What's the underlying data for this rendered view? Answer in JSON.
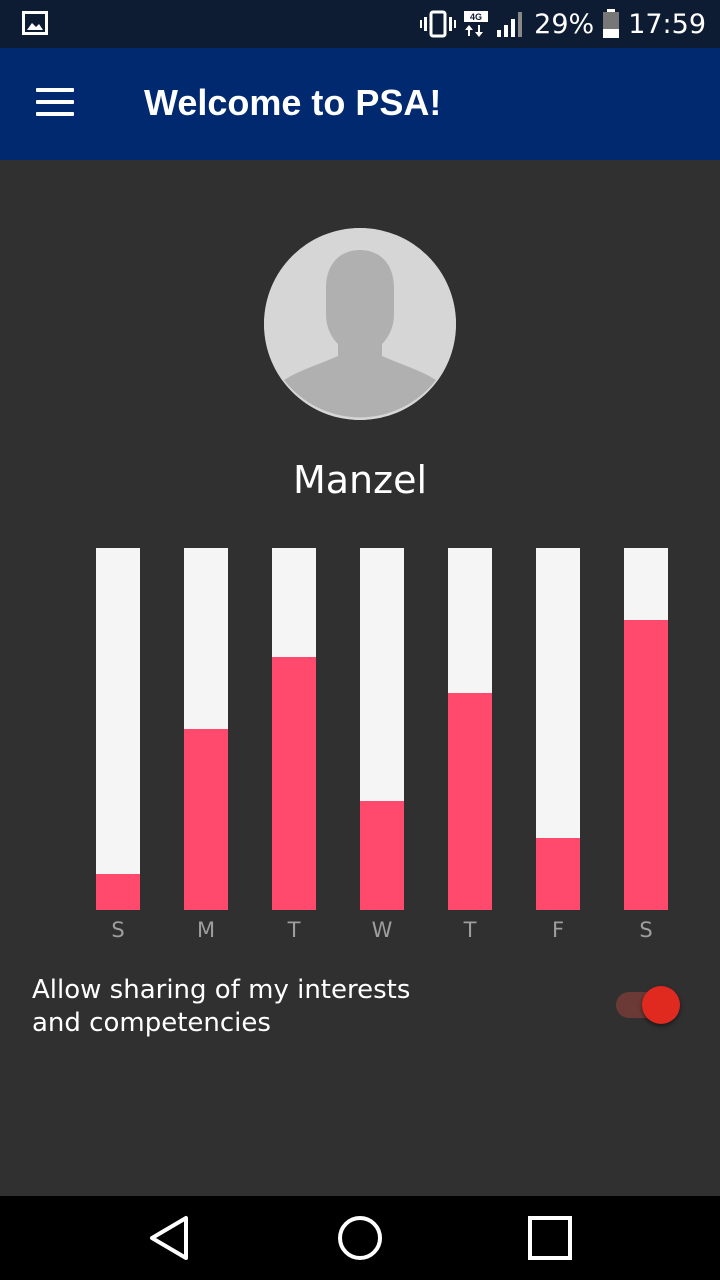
{
  "status_bar": {
    "battery": "29%",
    "time": "17:59",
    "network": "4G",
    "icons": [
      "image-icon",
      "vibrate-icon",
      "network-4g-icon",
      "signal-icon",
      "battery-icon"
    ]
  },
  "app_bar": {
    "title": "Welcome to PSA!",
    "menu_icon": "menu-icon",
    "color": "#012970"
  },
  "profile": {
    "name": "Manzel",
    "avatar_icon": "default-avatar-icon"
  },
  "chart_data": {
    "type": "bar",
    "categories": [
      "S",
      "M",
      "T",
      "W",
      "T",
      "F",
      "S"
    ],
    "values": [
      0.1,
      0.5,
      0.7,
      0.3,
      0.6,
      0.2,
      0.8
    ],
    "ylim": [
      0,
      1
    ],
    "fill_color": "#ff4a6d",
    "background_color": "#f5f5f5"
  },
  "sharing": {
    "label_line1": "Allow sharing of my interests",
    "label_line2": "and competencies",
    "enabled": true,
    "accent": "#e0291f"
  },
  "nav_bar": {
    "icons": [
      "back-icon",
      "home-icon",
      "recents-icon"
    ]
  }
}
